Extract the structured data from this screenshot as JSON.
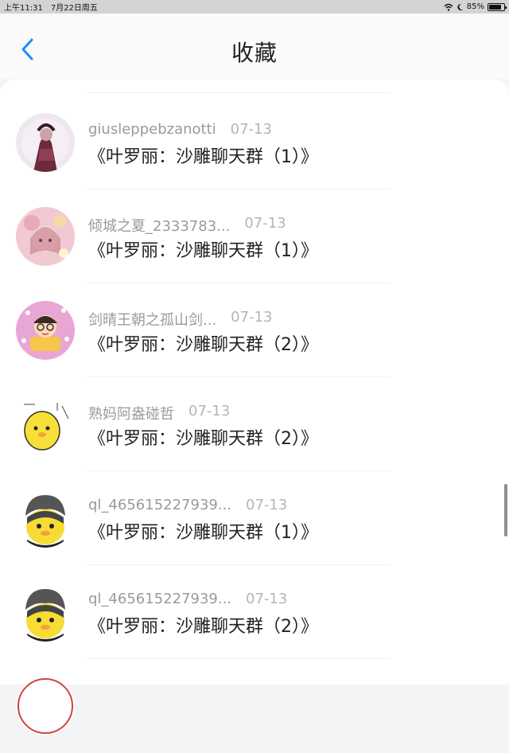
{
  "status": {
    "time": "上午11:31",
    "date": "7月22日周五",
    "battery": "85%",
    "battery_level": 0.85,
    "icons": [
      "wifi-icon",
      "moon-icon",
      "battery-icon"
    ]
  },
  "nav": {
    "title": "收藏",
    "back_icon": "chevron-left-icon",
    "accent": "#1a8dff"
  },
  "items": [
    {
      "name": "giusleppebzanotti",
      "date": "07-13",
      "message": "《叶罗丽：沙雕聊天群（1）》"
    },
    {
      "name": "倾城之夏_2333783...",
      "date": "07-13",
      "message": "《叶罗丽：沙雕聊天群（1）》"
    },
    {
      "name": "剑晴王朝之孤山剑...",
      "date": "07-13",
      "message": "《叶罗丽：沙雕聊天群（2）》"
    },
    {
      "name": "熟妈阿盎碰哲",
      "date": "07-13",
      "message": "《叶罗丽：沙雕聊天群（2）》"
    },
    {
      "name": "ql_465615227939...",
      "date": "07-13",
      "message": "《叶罗丽：沙雕聊天群（1）》"
    },
    {
      "name": "ql_465615227939...",
      "date": "07-13",
      "message": "《叶罗丽：沙雕聊天群（2）》"
    }
  ]
}
